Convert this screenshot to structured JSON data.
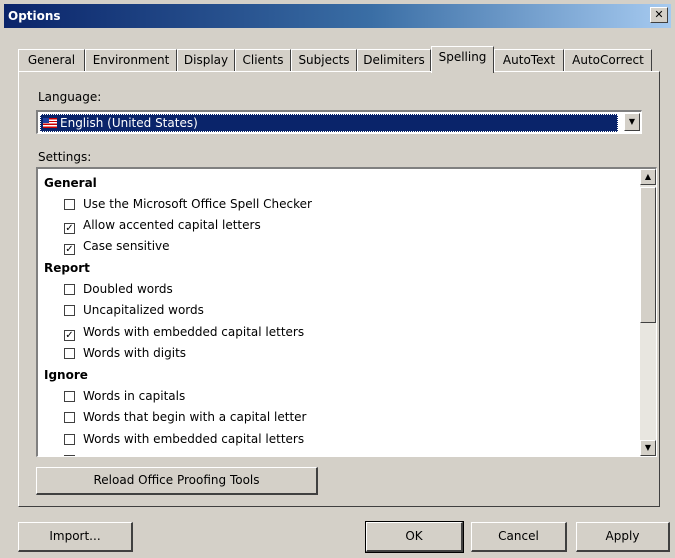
{
  "window": {
    "title": "Options",
    "close_glyph": "✕"
  },
  "tabs": [
    {
      "label": "General"
    },
    {
      "label": "Environment"
    },
    {
      "label": "Display"
    },
    {
      "label": "Clients"
    },
    {
      "label": "Subjects"
    },
    {
      "label": "Delimiters"
    },
    {
      "label": "Spelling",
      "active": true
    },
    {
      "label": "AutoText"
    },
    {
      "label": "AutoCorrect"
    }
  ],
  "spelling": {
    "language_label": "Language:",
    "language_value": "English (United States)",
    "settings_label": "Settings:",
    "groups": {
      "general": {
        "title": "General",
        "options": [
          {
            "label": "Use the Microsoft Office Spell Checker",
            "checked": false
          },
          {
            "label": "Allow accented capital letters",
            "checked": true
          },
          {
            "label": "Case sensitive",
            "checked": true
          }
        ]
      },
      "report": {
        "title": "Report",
        "options": [
          {
            "label": "Doubled words",
            "checked": false
          },
          {
            "label": "Uncapitalized words",
            "checked": false
          },
          {
            "label": "Words with embedded capital letters",
            "checked": true
          },
          {
            "label": "Words with digits",
            "checked": false
          }
        ]
      },
      "ignore": {
        "title": "Ignore",
        "options": [
          {
            "label": "Words in capitals",
            "checked": false
          },
          {
            "label": "Words that begin with a capital letter",
            "checked": false
          },
          {
            "label": "Words with embedded capital letters",
            "checked": false
          }
        ]
      }
    },
    "reload_button": "Reload Office Proofing Tools"
  },
  "footer": {
    "import_button": "Import...",
    "ok_button": "OK",
    "cancel_button": "Cancel",
    "apply_button": "Apply"
  },
  "icons": {
    "dropdown": "chevron-down-icon",
    "scroll_up": "arrow-up-icon",
    "scroll_down": "arrow-down-icon",
    "check": "checkmark-icon"
  },
  "colors": {
    "titlebar_start": "#0a246a",
    "titlebar_end": "#a6caf0",
    "selection": "#0a246a",
    "face": "#d4d0c8"
  }
}
